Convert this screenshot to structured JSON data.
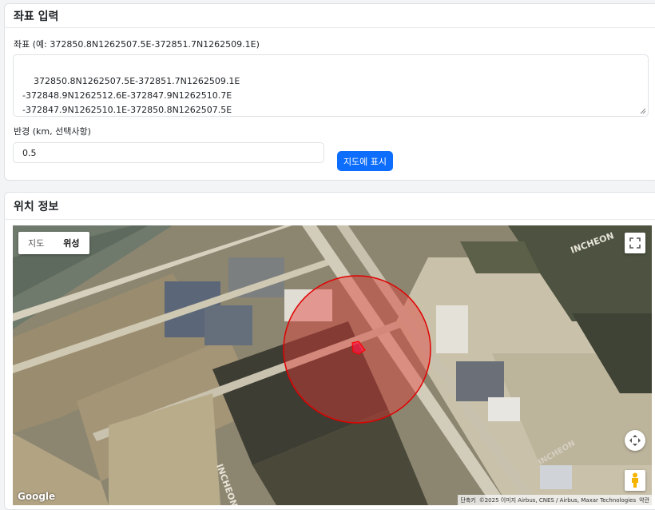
{
  "input_card": {
    "title": "좌표 입력",
    "coord_label": "좌표 (예: 372850.8N1262507.5E-372851.7N1262509.1E)",
    "coord_value": "372850.8N1262507.5E-372851.7N1262509.1E\n-372848.9N1262512.6E-372847.9N1262510.7E\n-372847.9N1262510.1E-372850.8N1262507.5E",
    "radius_label": "반경 (km, 선택사항)",
    "radius_value": "0.5",
    "show_button": "지도에 표시"
  },
  "location_card": {
    "title": "위치 정보",
    "map": {
      "type_road": "지도",
      "type_satellite": "위성",
      "selected_type": "위성",
      "logo": "Google",
      "attribution_shortcuts": "단축키",
      "attribution_imagery": "©2025 이미지 Airbus, CNES / Airbus, Maxar Technologies",
      "attribution_terms": "약관",
      "labels": [
        "INCHEON",
        "INCHEON",
        "INCHEON"
      ],
      "circle_fill": "#e53935",
      "polygon_fill": "#ff1744"
    }
  }
}
